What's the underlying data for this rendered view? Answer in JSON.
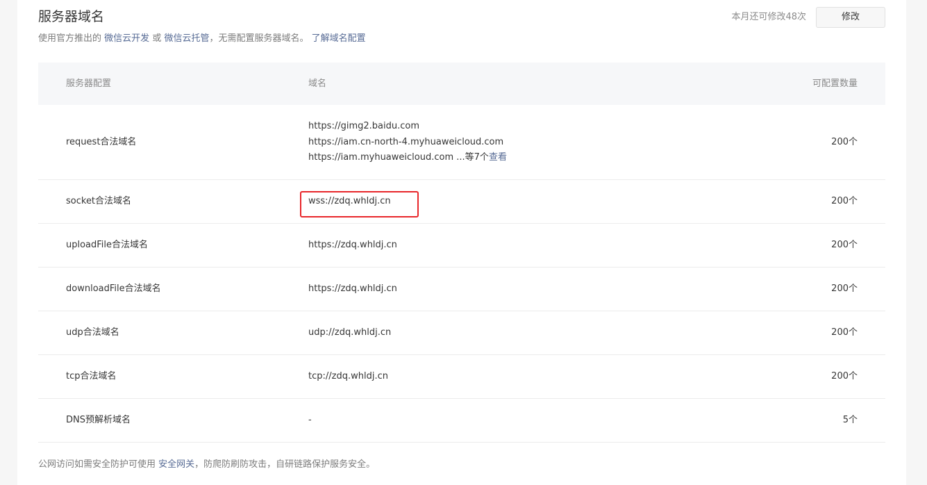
{
  "header": {
    "title": "服务器域名",
    "subtitle_prefix": "使用官方推出的",
    "subtitle_link1": "微信云开发",
    "subtitle_or": "或",
    "subtitle_link2": "微信云托管",
    "subtitle_suffix": "，无需配置服务器域名。",
    "subtitle_link3": "了解域名配置",
    "quota_text": "本月还可修改48次",
    "edit_button": "修改"
  },
  "table": {
    "columns": [
      "服务器配置",
      "域名",
      "可配置数量"
    ],
    "rows": [
      {
        "config": "request合法域名",
        "domains": [
          "https://gimg2.baidu.com",
          "https://iam.cn-north-4.myhuaweicloud.com",
          "https://iam.myhuaweicloud.com"
        ],
        "more_text": "...等7个",
        "view_link": "查看",
        "count": "200个"
      },
      {
        "config": "socket合法域名",
        "domain": "wss://zdq.whldj.cn",
        "count": "200个"
      },
      {
        "config": "uploadFile合法域名",
        "domain": "https://zdq.whldj.cn",
        "count": "200个"
      },
      {
        "config": "downloadFile合法域名",
        "domain": "https://zdq.whldj.cn",
        "count": "200个"
      },
      {
        "config": "udp合法域名",
        "domain": "udp://zdq.whldj.cn",
        "count": "200个"
      },
      {
        "config": "tcp合法域名",
        "domain": "tcp://zdq.whldj.cn",
        "count": "200个"
      },
      {
        "config": "DNS预解析域名",
        "domain": "-",
        "count": "5个"
      }
    ]
  },
  "footer": {
    "prefix": "公网访问如需安全防护可使用",
    "link": "安全网关",
    "suffix": "，防爬防刷防攻击，自研链路保护服务安全。"
  },
  "colors": {
    "link": "#576b95",
    "highlight_border": "#e8262a",
    "header_bg": "#f6f7f9"
  }
}
